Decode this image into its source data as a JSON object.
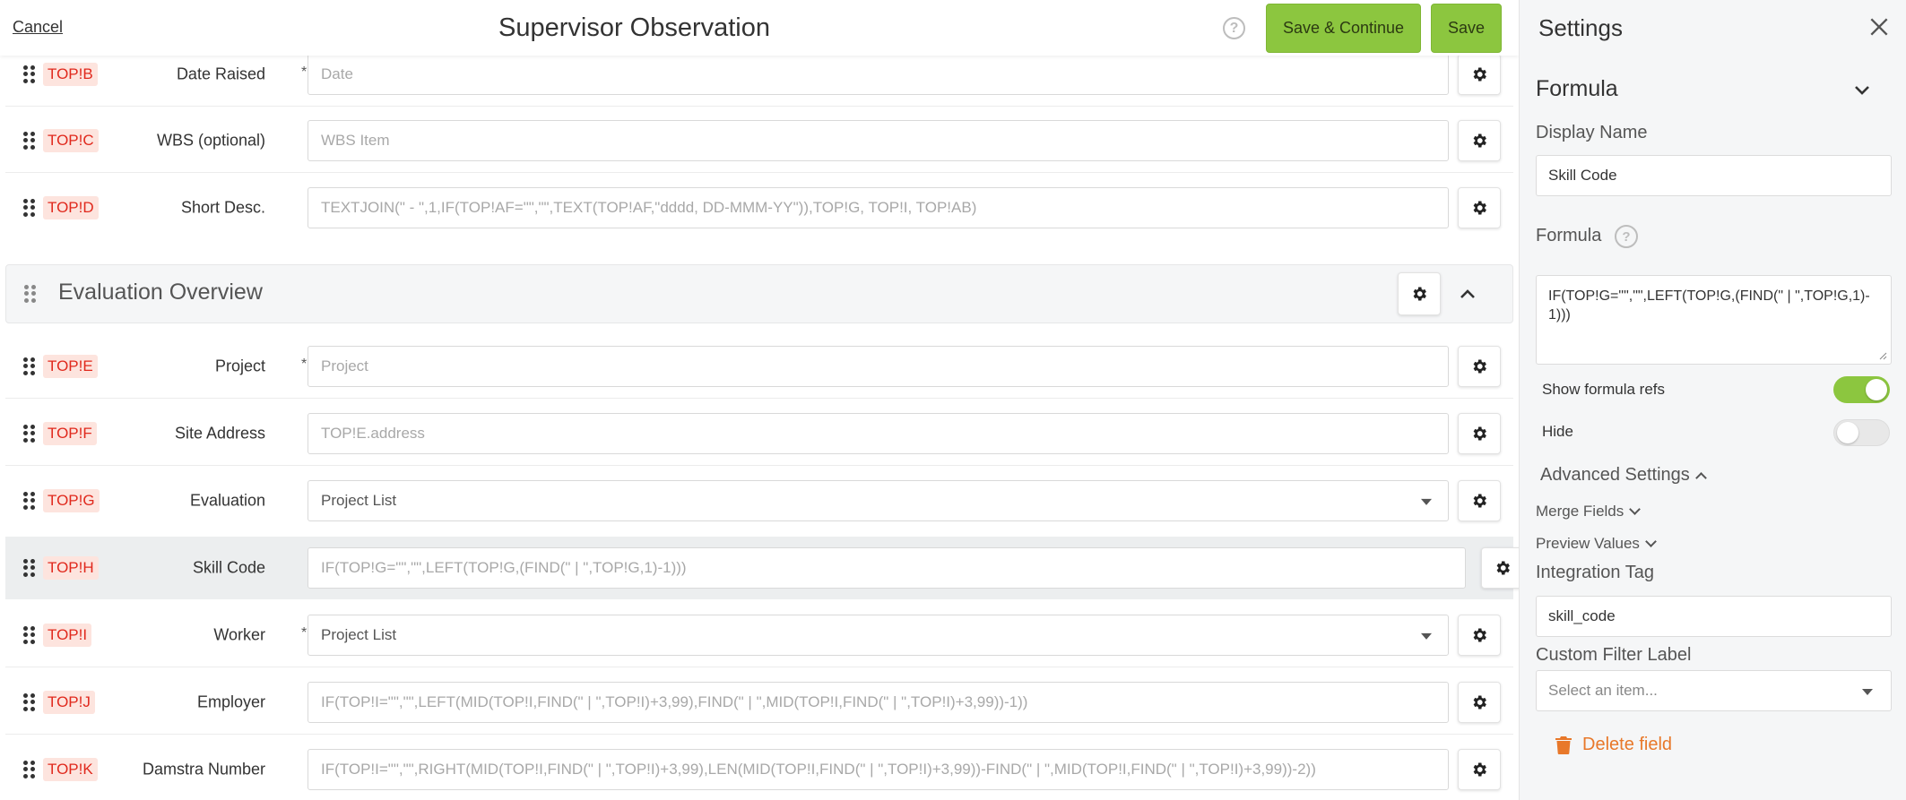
{
  "header": {
    "cancel_label": "Cancel",
    "title": "Supervisor Observation",
    "help_icon": "?",
    "save_continue_label": "Save & Continue",
    "save_label": "Save"
  },
  "rows_top": [
    {
      "tag": "TOP!B",
      "label": "Date Raised",
      "required": "*",
      "placeholder": "Date",
      "kind": "text"
    },
    {
      "tag": "TOP!C",
      "label": "WBS (optional)",
      "required": "",
      "placeholder": "WBS Item",
      "kind": "text"
    },
    {
      "tag": "TOP!D",
      "label": "Short Desc.",
      "required": "",
      "placeholder": "TEXTJOIN(\" - \",1,IF(TOP!AF=\"\",\"\",TEXT(TOP!AF,\"dddd, DD-MMM-YY\")),TOP!G, TOP!I, TOP!AB)",
      "kind": "text"
    }
  ],
  "section": {
    "title": "Evaluation Overview"
  },
  "rows_bottom": [
    {
      "tag": "TOP!E",
      "label": "Project",
      "required": "*",
      "placeholder": "Project",
      "kind": "text"
    },
    {
      "tag": "TOP!F",
      "label": "Site Address",
      "required": "",
      "placeholder": "TOP!E.address",
      "kind": "text"
    },
    {
      "tag": "TOP!G",
      "label": "Evaluation",
      "required": "",
      "placeholder": "Project List",
      "kind": "select"
    },
    {
      "tag": "TOP!H",
      "label": "Skill Code",
      "required": "",
      "placeholder": "IF(TOP!G=\"\",\"\",LEFT(TOP!G,(FIND(\" | \",TOP!G,1)-1)))",
      "kind": "text",
      "selected": true
    },
    {
      "tag": "TOP!I",
      "label": "Worker",
      "required": "*",
      "placeholder": "Project List",
      "kind": "select"
    },
    {
      "tag": "TOP!J",
      "label": "Employer",
      "required": "",
      "placeholder": "IF(TOP!I=\"\",\"\",LEFT(MID(TOP!I,FIND(\" | \",TOP!I)+3,99),FIND(\" | \",MID(TOP!I,FIND(\" | \",TOP!I)+3,99))-1))",
      "kind": "text"
    },
    {
      "tag": "TOP!K",
      "label": "Damstra Number",
      "required": "",
      "placeholder": "IF(TOP!I=\"\",\"\",RIGHT(MID(TOP!I,FIND(\" | \",TOP!I)+3,99),LEN(MID(TOP!I,FIND(\" | \",TOP!I)+3,99))-FIND(\" | \",MID(TOP!I,FIND(\" | \",TOP!I)+3,99))-2))",
      "kind": "text"
    }
  ],
  "settings": {
    "title": "Settings",
    "field_type": "Formula",
    "display_name_label": "Display Name",
    "display_name_value": "Skill Code",
    "formula_label": "Formula",
    "formula_value": "IF(TOP!G=\"\",\"\",LEFT(TOP!G,(FIND(\" | \",TOP!G,1)-1)))",
    "show_refs_label": "Show formula refs",
    "show_refs_on": true,
    "hide_label": "Hide",
    "hide_on": false,
    "advanced_label": "Advanced Settings",
    "merge_fields_label": "Merge Fields",
    "preview_values_label": "Preview Values",
    "integration_tag_label": "Integration Tag",
    "integration_tag_value": "skill_code",
    "custom_filter_label": "Custom Filter Label",
    "custom_filter_placeholder": "Select an item...",
    "delete_label": "Delete field"
  },
  "colors": {
    "accent_green": "#8cc63f",
    "tag_red": "#e0281c",
    "tag_bg": "#fde4de",
    "delete_orange": "#e8782a"
  }
}
